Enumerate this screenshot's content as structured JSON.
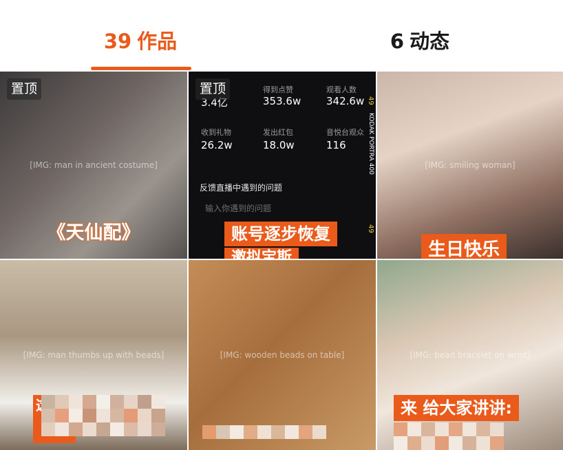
{
  "tabs": {
    "works": {
      "count": "39",
      "label": "作品"
    },
    "dynamics": {
      "count": "6",
      "label": "动态"
    }
  },
  "pin_label": "置顶",
  "cells": {
    "c1": {
      "caption": "《天仙配》"
    },
    "c2": {
      "stats": [
        {
          "label": "",
          "value": "3.4亿"
        },
        {
          "label": "得到点赞",
          "value": "353.6w"
        },
        {
          "label": "观看人数",
          "value": "342.6w"
        },
        {
          "label": "收到礼物",
          "value": "26.2w"
        },
        {
          "label": "发出红包",
          "value": "18.0w"
        },
        {
          "label": "音悦台观众",
          "value": "116"
        }
      ],
      "feedback": "反馈直播中遇到的问题",
      "input_placeholder": "输入你遇到的问题",
      "caption": "账号逐步恢复",
      "caption2": "邀拟宝斯",
      "side_brand": "KODAK PORTRA 400",
      "side_num": "49"
    },
    "c3": {
      "caption": "生日快乐"
    },
    "c4": {
      "caption": "这条"
    },
    "c6": {
      "caption": "来 给大家讲讲:"
    }
  },
  "colors": {
    "accent": "#ea5a1b"
  }
}
